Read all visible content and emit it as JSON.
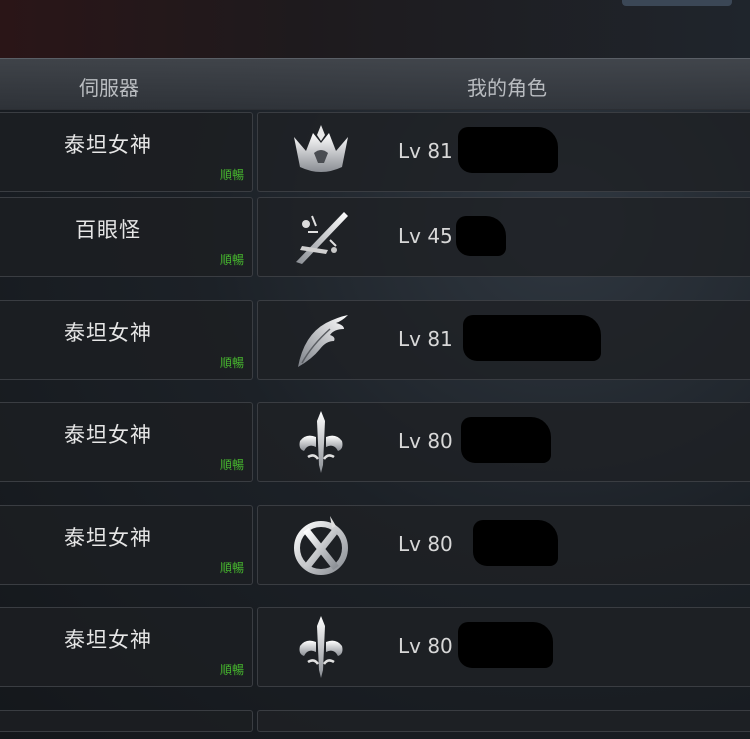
{
  "header": {
    "server_col": "伺服器",
    "char_col": "我的角色"
  },
  "rows": [
    {
      "server": "泰坦女神",
      "status": "順暢",
      "icon": "crown-icon",
      "level": "Lv 81"
    },
    {
      "server": "百眼怪",
      "status": "順暢",
      "icon": "crossed-blades-icon",
      "level": "Lv 45"
    },
    {
      "server": "泰坦女神",
      "status": "順暢",
      "icon": "wing-icon",
      "level": "Lv 81"
    },
    {
      "server": "泰坦女神",
      "status": "順暢",
      "icon": "ornate-sword-icon",
      "level": "Lv 80"
    },
    {
      "server": "泰坦女神",
      "status": "順暢",
      "icon": "serpent-emblem-icon",
      "level": "Lv 80"
    },
    {
      "server": "泰坦女神",
      "status": "順暢",
      "icon": "ornate-sword-icon",
      "level": "Lv 80"
    }
  ],
  "colors": {
    "status": "#46b52e",
    "header_bg": "#464a50",
    "row_bg": "#1e2125"
  }
}
